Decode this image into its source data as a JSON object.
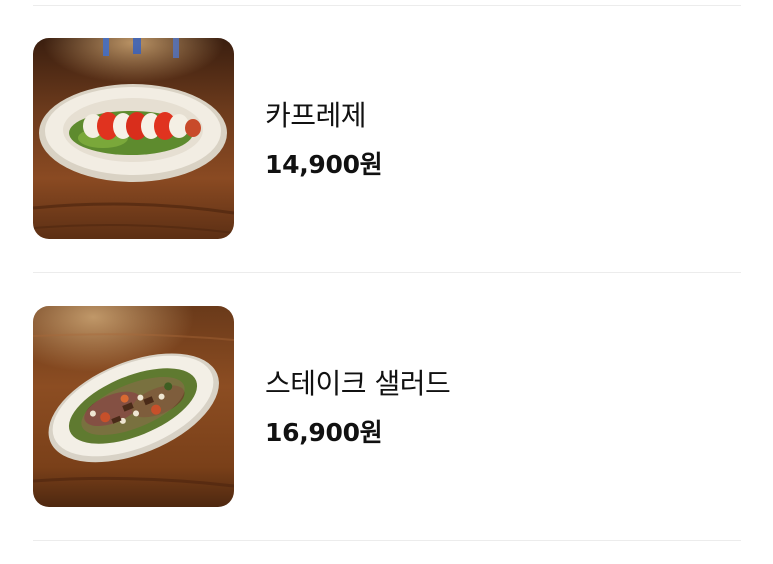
{
  "menu": {
    "items": [
      {
        "name": "카프레제",
        "price": "14,900원",
        "image": "caprese-salad-photo"
      },
      {
        "name": "스테이크 샐러드",
        "price": "16,900원",
        "image": "steak-salad-photo"
      }
    ]
  }
}
